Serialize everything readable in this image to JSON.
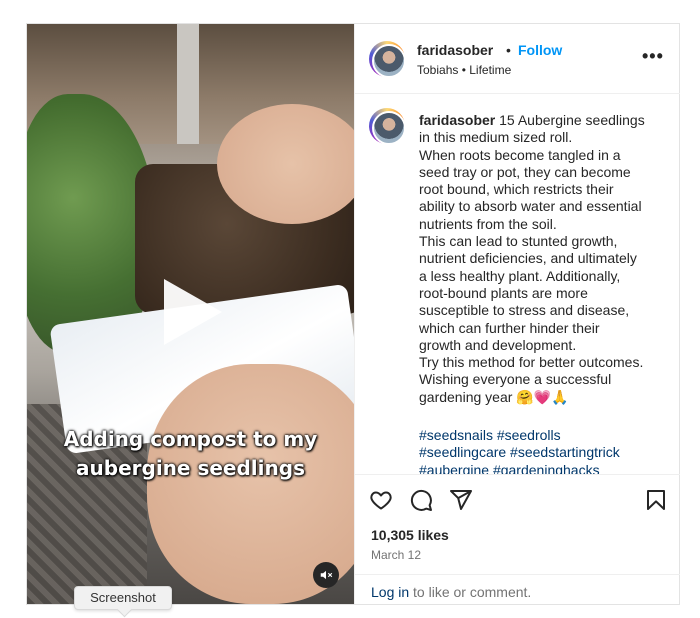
{
  "video": {
    "caption_line1": "Adding compost to my",
    "caption_line2": "aubergine seedlings"
  },
  "header": {
    "username": "faridasober",
    "separator": "•",
    "follow_label": "Follow",
    "subline": "Tobiahs • Lifetime",
    "more_label": "•••"
  },
  "comment": {
    "username": "faridasober",
    "lines": [
      " 15 Aubergine seedlings",
      "in this medium sized roll.",
      "When roots become tangled in a",
      "seed tray or pot, they can become",
      "root bound, which restricts their",
      "ability to absorb water and essential",
      "nutrients from the soil.",
      "This can lead to stunted growth,",
      "nutrient deficiencies, and ultimately",
      "a less healthy plant. Additionally,",
      "root-bound plants are more",
      "susceptible to stress and disease,",
      "which can further hinder their",
      "growth and development.",
      "Try this method for better outcomes.",
      "Wishing everyone a successful",
      "gardening year 🤗💗🙏"
    ],
    "hashtags": [
      "#seedsnails #seedrolls",
      "#seedlingcare #seedstartingtrick",
      "#aubergine #gardeninghacks"
    ]
  },
  "engagement": {
    "likes": "10,305 likes",
    "date": "March 12",
    "login_link": "Log in",
    "login_rest": " to like or comment."
  },
  "tooltip": {
    "label": "Screenshot"
  },
  "icons": [
    "heart-icon",
    "comment-icon",
    "share-icon",
    "bookmark-icon",
    "play-icon",
    "mute-icon"
  ]
}
